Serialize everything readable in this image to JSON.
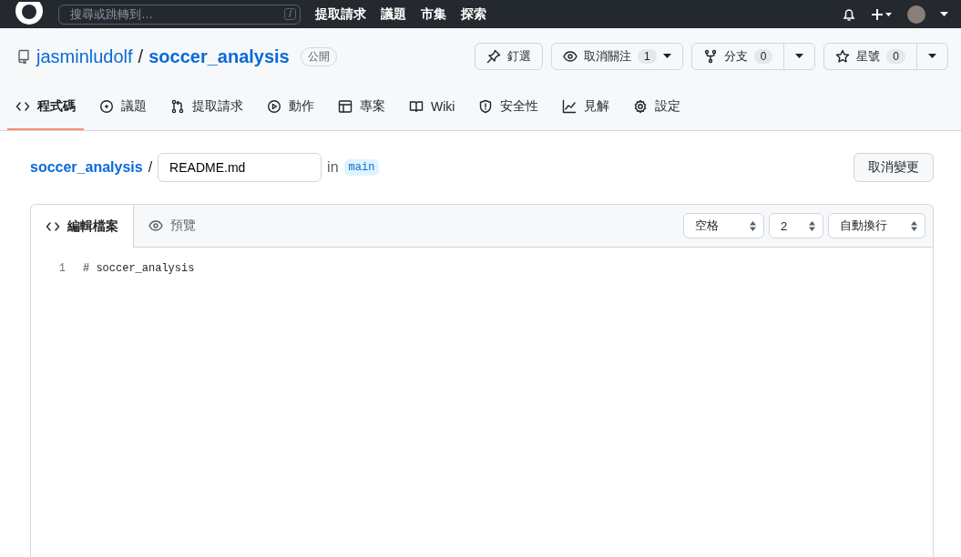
{
  "header": {
    "search": {
      "placeholder": "搜尋或跳轉到…",
      "shortcut": "/"
    },
    "nav": [
      "提取請求",
      "議題",
      "市集",
      "探索"
    ]
  },
  "repo": {
    "owner": "jasminludolf",
    "separator": "/",
    "name": "soccer_analysis",
    "visibility": "公開",
    "actions": [
      {
        "kind": "plain",
        "label": "釘選"
      },
      {
        "kind": "menu",
        "label": "取消關注",
        "count": "1"
      },
      {
        "kind": "split",
        "label": "分支",
        "count": "0"
      },
      {
        "kind": "split",
        "label": "星號",
        "count": "0"
      }
    ]
  },
  "tabs": [
    {
      "label": "程式碼",
      "selected": true
    },
    {
      "label": "議題",
      "selected": false
    },
    {
      "label": "提取請求",
      "selected": false
    },
    {
      "label": "動作",
      "selected": false
    },
    {
      "label": "專案",
      "selected": false
    },
    {
      "label": "Wiki",
      "selected": false
    },
    {
      "label": "安全性",
      "selected": false
    },
    {
      "label": "見解",
      "selected": false
    },
    {
      "label": "設定",
      "selected": false
    }
  ],
  "breadcrumb": {
    "repo": "soccer_analysis",
    "separator": "/",
    "filename": "README.md",
    "in": "in",
    "branch": "main"
  },
  "cancel_button": "取消變更",
  "editor": {
    "tabs": [
      {
        "label": "編輯檔案",
        "selected": true
      },
      {
        "label": "預覽",
        "selected": false
      }
    ],
    "selects": [
      "空格",
      "2",
      "自動換行"
    ],
    "lines": [
      {
        "number": "1",
        "text": "# soccer_analysis"
      }
    ]
  }
}
